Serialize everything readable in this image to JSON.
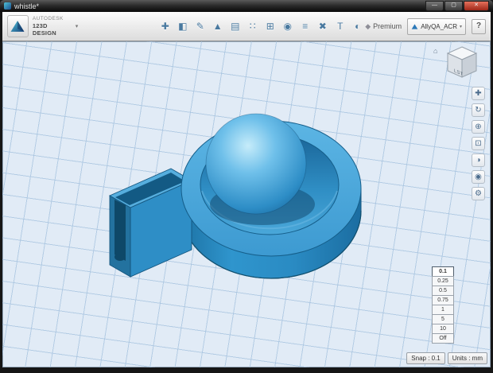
{
  "window": {
    "title": "whistle*",
    "controls": {
      "minimize": "—",
      "maximize": "▢",
      "close": "✕"
    }
  },
  "toolbar": {
    "brand_line1": "AUTODESK",
    "brand_line2": "123D DESIGN",
    "menu_chevron": "▾",
    "icons": [
      {
        "name": "transform",
        "glyph": "✚"
      },
      {
        "name": "primitives",
        "glyph": "◧"
      },
      {
        "name": "sketch",
        "glyph": "✎"
      },
      {
        "name": "construct",
        "glyph": "▲"
      },
      {
        "name": "modify",
        "glyph": "▤"
      },
      {
        "name": "pattern",
        "glyph": "∷"
      },
      {
        "name": "grouping",
        "glyph": "⊞"
      },
      {
        "name": "combine",
        "glyph": "◉"
      },
      {
        "name": "snap",
        "glyph": "≡"
      },
      {
        "name": "delete",
        "glyph": "✖"
      },
      {
        "name": "text",
        "glyph": "T"
      },
      {
        "name": "material",
        "glyph": "◐"
      }
    ],
    "premium_icon": "◆",
    "premium_label": "Premium",
    "account_label": "AllyQA_ACR",
    "account_chevron": "▾",
    "help_label": "?"
  },
  "viewport": {
    "viewcube_label": "LST",
    "home_icon": "⌂",
    "nav_icons": [
      {
        "name": "pan",
        "glyph": "✚"
      },
      {
        "name": "orbit",
        "glyph": "↻"
      },
      {
        "name": "zoom",
        "glyph": "⊕"
      },
      {
        "name": "fit",
        "glyph": "⊡"
      },
      {
        "name": "shading",
        "glyph": "◑"
      },
      {
        "name": "visibility",
        "glyph": "◉"
      },
      {
        "name": "settings",
        "glyph": "⚙"
      }
    ]
  },
  "snap_menu": {
    "options": [
      "0.1",
      "0.25",
      "0.5",
      "0.75",
      "1",
      "5",
      "10",
      "Off"
    ],
    "selected": "0.1"
  },
  "statusbar": {
    "snap_label": "Snap : 0.1",
    "units_label": "Units : mm"
  },
  "colors": {
    "model_blue": "#2e8ec6",
    "model_dark": "#14567f",
    "sphere_highlight": "#c6ecfa",
    "canvas_bg": "#e1ebf6",
    "grid_line": "#a8c4e0",
    "close_red": "#b23422"
  }
}
